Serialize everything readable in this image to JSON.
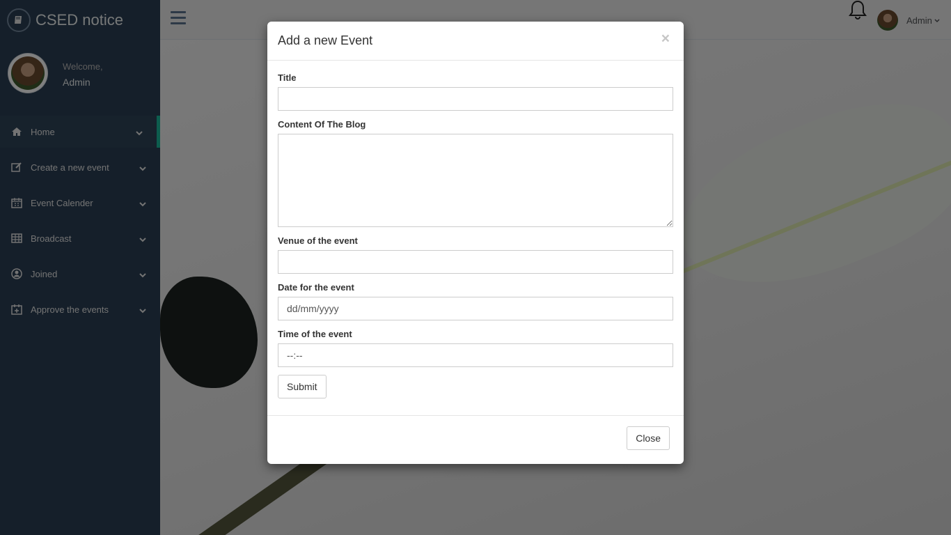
{
  "app": {
    "title": "CSED notice",
    "logo_icon": "book-icon"
  },
  "profile": {
    "welcome": "Welcome,",
    "name": "Admin"
  },
  "sidebar": {
    "items": [
      {
        "label": "Home",
        "icon": "home-icon",
        "active": true
      },
      {
        "label": "Create a new event",
        "icon": "edit-icon"
      },
      {
        "label": "Event Calender",
        "icon": "calendar-icon"
      },
      {
        "label": "Broadcast",
        "icon": "table-icon"
      },
      {
        "label": "Joined",
        "icon": "user-circle-icon"
      },
      {
        "label": "Approve the events",
        "icon": "calendar-plus-icon"
      }
    ]
  },
  "topnav": {
    "user_name": "Admin"
  },
  "modal": {
    "title": "Add a new Event",
    "close_glyph": "×",
    "fields": {
      "title_label": "Title",
      "title_value": "",
      "content_label": "Content Of The Blog",
      "content_value": "",
      "venue_label": "Venue of the event",
      "venue_value": "",
      "date_label": "Date for the event",
      "date_placeholder": "dd/mm/yyyy",
      "time_label": "Time of the event",
      "time_placeholder": "--:--"
    },
    "submit_label": "Submit",
    "close_label": "Close"
  },
  "colors": {
    "sidebar_bg": "#2a3f54",
    "active_accent": "#1abb9c"
  }
}
